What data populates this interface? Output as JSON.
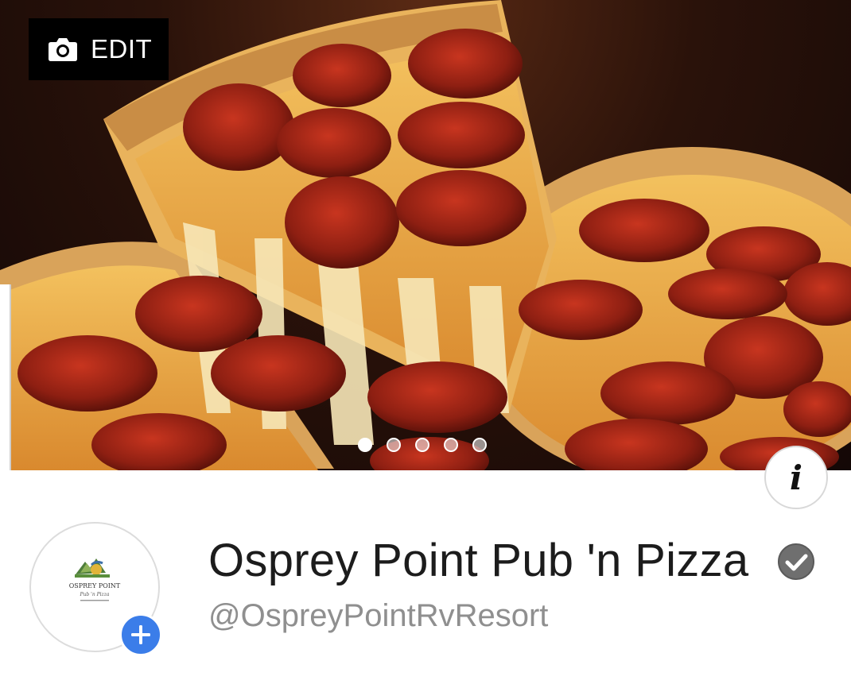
{
  "cover": {
    "edit_label": "EDIT",
    "camera_icon": "camera-icon",
    "photo_count": 5,
    "active_photo_index": 0
  },
  "info_icon": "info-icon",
  "page": {
    "name": "Osprey Point Pub 'n Pizza",
    "handle": "@OspreyPointRvResort",
    "verified_icon": "check-circle-icon"
  },
  "profile": {
    "logo_text_line1": "OSPREY POINT",
    "logo_text_line2": "Pub 'n Pizza",
    "add_icon": "plus-icon"
  },
  "colors": {
    "accent": "#3b7de9",
    "name_text": "#1c1c1c",
    "handle_text": "#8f8f8f",
    "verified_badge": "#6f6f6f"
  }
}
